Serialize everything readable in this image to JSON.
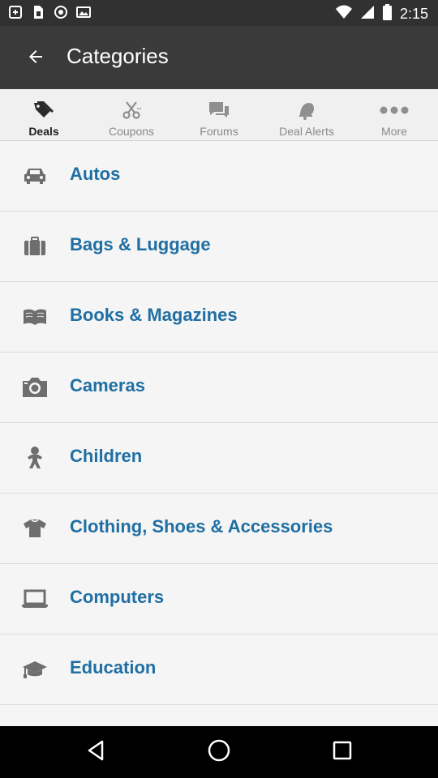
{
  "status_bar": {
    "time": "2:15"
  },
  "app_bar": {
    "title": "Categories"
  },
  "tabs": [
    {
      "label": "Deals",
      "icon": "tag-icon",
      "active": true
    },
    {
      "label": "Coupons",
      "icon": "scissors-icon",
      "active": false
    },
    {
      "label": "Forums",
      "icon": "chat-icon",
      "active": false
    },
    {
      "label": "Deal Alerts",
      "icon": "bell-icon",
      "active": false
    },
    {
      "label": "More",
      "icon": "more-icon",
      "active": false
    }
  ],
  "categories": [
    {
      "label": "Autos",
      "icon": "car-icon"
    },
    {
      "label": "Bags & Luggage",
      "icon": "briefcase-icon"
    },
    {
      "label": "Books & Magazines",
      "icon": "book-icon"
    },
    {
      "label": "Cameras",
      "icon": "camera-icon"
    },
    {
      "label": "Children",
      "icon": "child-icon"
    },
    {
      "label": "Clothing, Shoes & Accessories",
      "icon": "shirt-icon"
    },
    {
      "label": "Computers",
      "icon": "laptop-icon"
    },
    {
      "label": "Education",
      "icon": "graduation-cap-icon"
    }
  ],
  "colors": {
    "accent_text": "#1f6fa3",
    "icon_gray": "#6e6e6e",
    "app_bar": "#3a3a3a"
  }
}
